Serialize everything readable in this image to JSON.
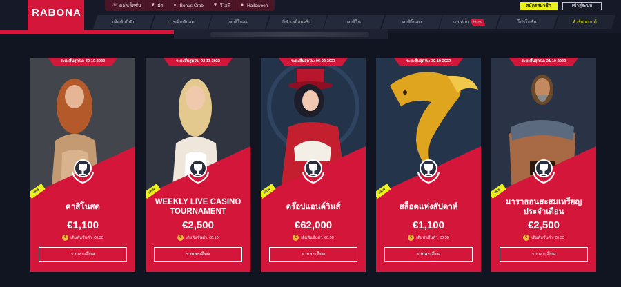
{
  "brand": {
    "logo": "RABONA",
    "accent": "#d4163b",
    "highlight": "#eaf11d"
  },
  "quick_links": [
    {
      "icon": "phone-icon",
      "glyph": "☏",
      "label": "ดอลเล็คชั่น"
    },
    {
      "icon": "gift-icon",
      "glyph": "♥",
      "label": "ผัด"
    },
    {
      "icon": "bonus-crab-icon",
      "glyph": "♦",
      "label": "Bonus Crab"
    },
    {
      "icon": "heart-icon",
      "glyph": "♥",
      "label": "วีไอพี"
    },
    {
      "icon": "pumpkin-icon",
      "glyph": "●",
      "label": "Halloween"
    }
  ],
  "auth": {
    "signup": "สมัครสมาชิก",
    "login": "เข้าสู่ระบบ"
  },
  "nav": [
    {
      "label": "เดิมพันกีฬา",
      "active": false,
      "badge": ""
    },
    {
      "label": "การเดิมพันสด",
      "active": false,
      "badge": ""
    },
    {
      "label": "คาสิโนสด",
      "active": false,
      "badge": ""
    },
    {
      "label": "กีฬาเสมือนจริง",
      "active": false,
      "badge": ""
    },
    {
      "label": "คาสิโน",
      "active": false,
      "badge": ""
    },
    {
      "label": "คาสิโนสด",
      "active": false,
      "badge": ""
    },
    {
      "label": "เกมด่วน",
      "active": false,
      "badge": "New"
    },
    {
      "label": "โปรโมชั่น",
      "active": false,
      "badge": ""
    },
    {
      "label": "ทัวร์นาเมนต์",
      "active": true,
      "badge": ""
    }
  ],
  "cards": [
    {
      "date": "ระยะสิ้นสุดใน: 30-10-2022",
      "new_label": "NEW",
      "title": "คาสิโนสด",
      "prize": "€1,100",
      "bet": "เดิมพันขั้นต่ำ: €0.30",
      "button": "รายละเอียด",
      "image": "woman-in-gold-dress"
    },
    {
      "date": "ระยะสิ้นสุดใน: 02-11-2022",
      "new_label": "NEW",
      "title": "WEEKLY LIVE CASINO TOURNAMENT",
      "prize": "€2,500",
      "bet": "เดิมพันขั้นต่ำ: €0.10",
      "button": "รายละเอียด",
      "image": "blonde-woman"
    },
    {
      "date": "ระยะสิ้นสุดใน: 06-02-2023",
      "new_label": "NEW",
      "title": "ดร๊อปแอนด์วินส์",
      "prize": "€62,000",
      "bet": "เดิมพันขั้นต่ำ: €0.50",
      "button": "รายละเอียด",
      "image": "steampunk-woman"
    },
    {
      "date": "ระยะสิ้นสุดใน: 30-10-2022",
      "new_label": "NEW",
      "title": "สล็อตแห่งสัปดาห์",
      "prize": "€1,100",
      "bet": "เดิมพันขั้นต่ำ: €0.30",
      "button": "รายละเอียด",
      "image": "golden-fish"
    },
    {
      "date": "ระยะสิ้นสุดใน: 21-10-2022",
      "new_label": "NEW",
      "title": "มาราธอนสะสมเหรียญประจำเดือน",
      "prize": "€2,500",
      "bet": "เดิมพันขั้นต่ำ: €0.30",
      "button": "รายละเอียด",
      "image": "warrior-man"
    }
  ]
}
